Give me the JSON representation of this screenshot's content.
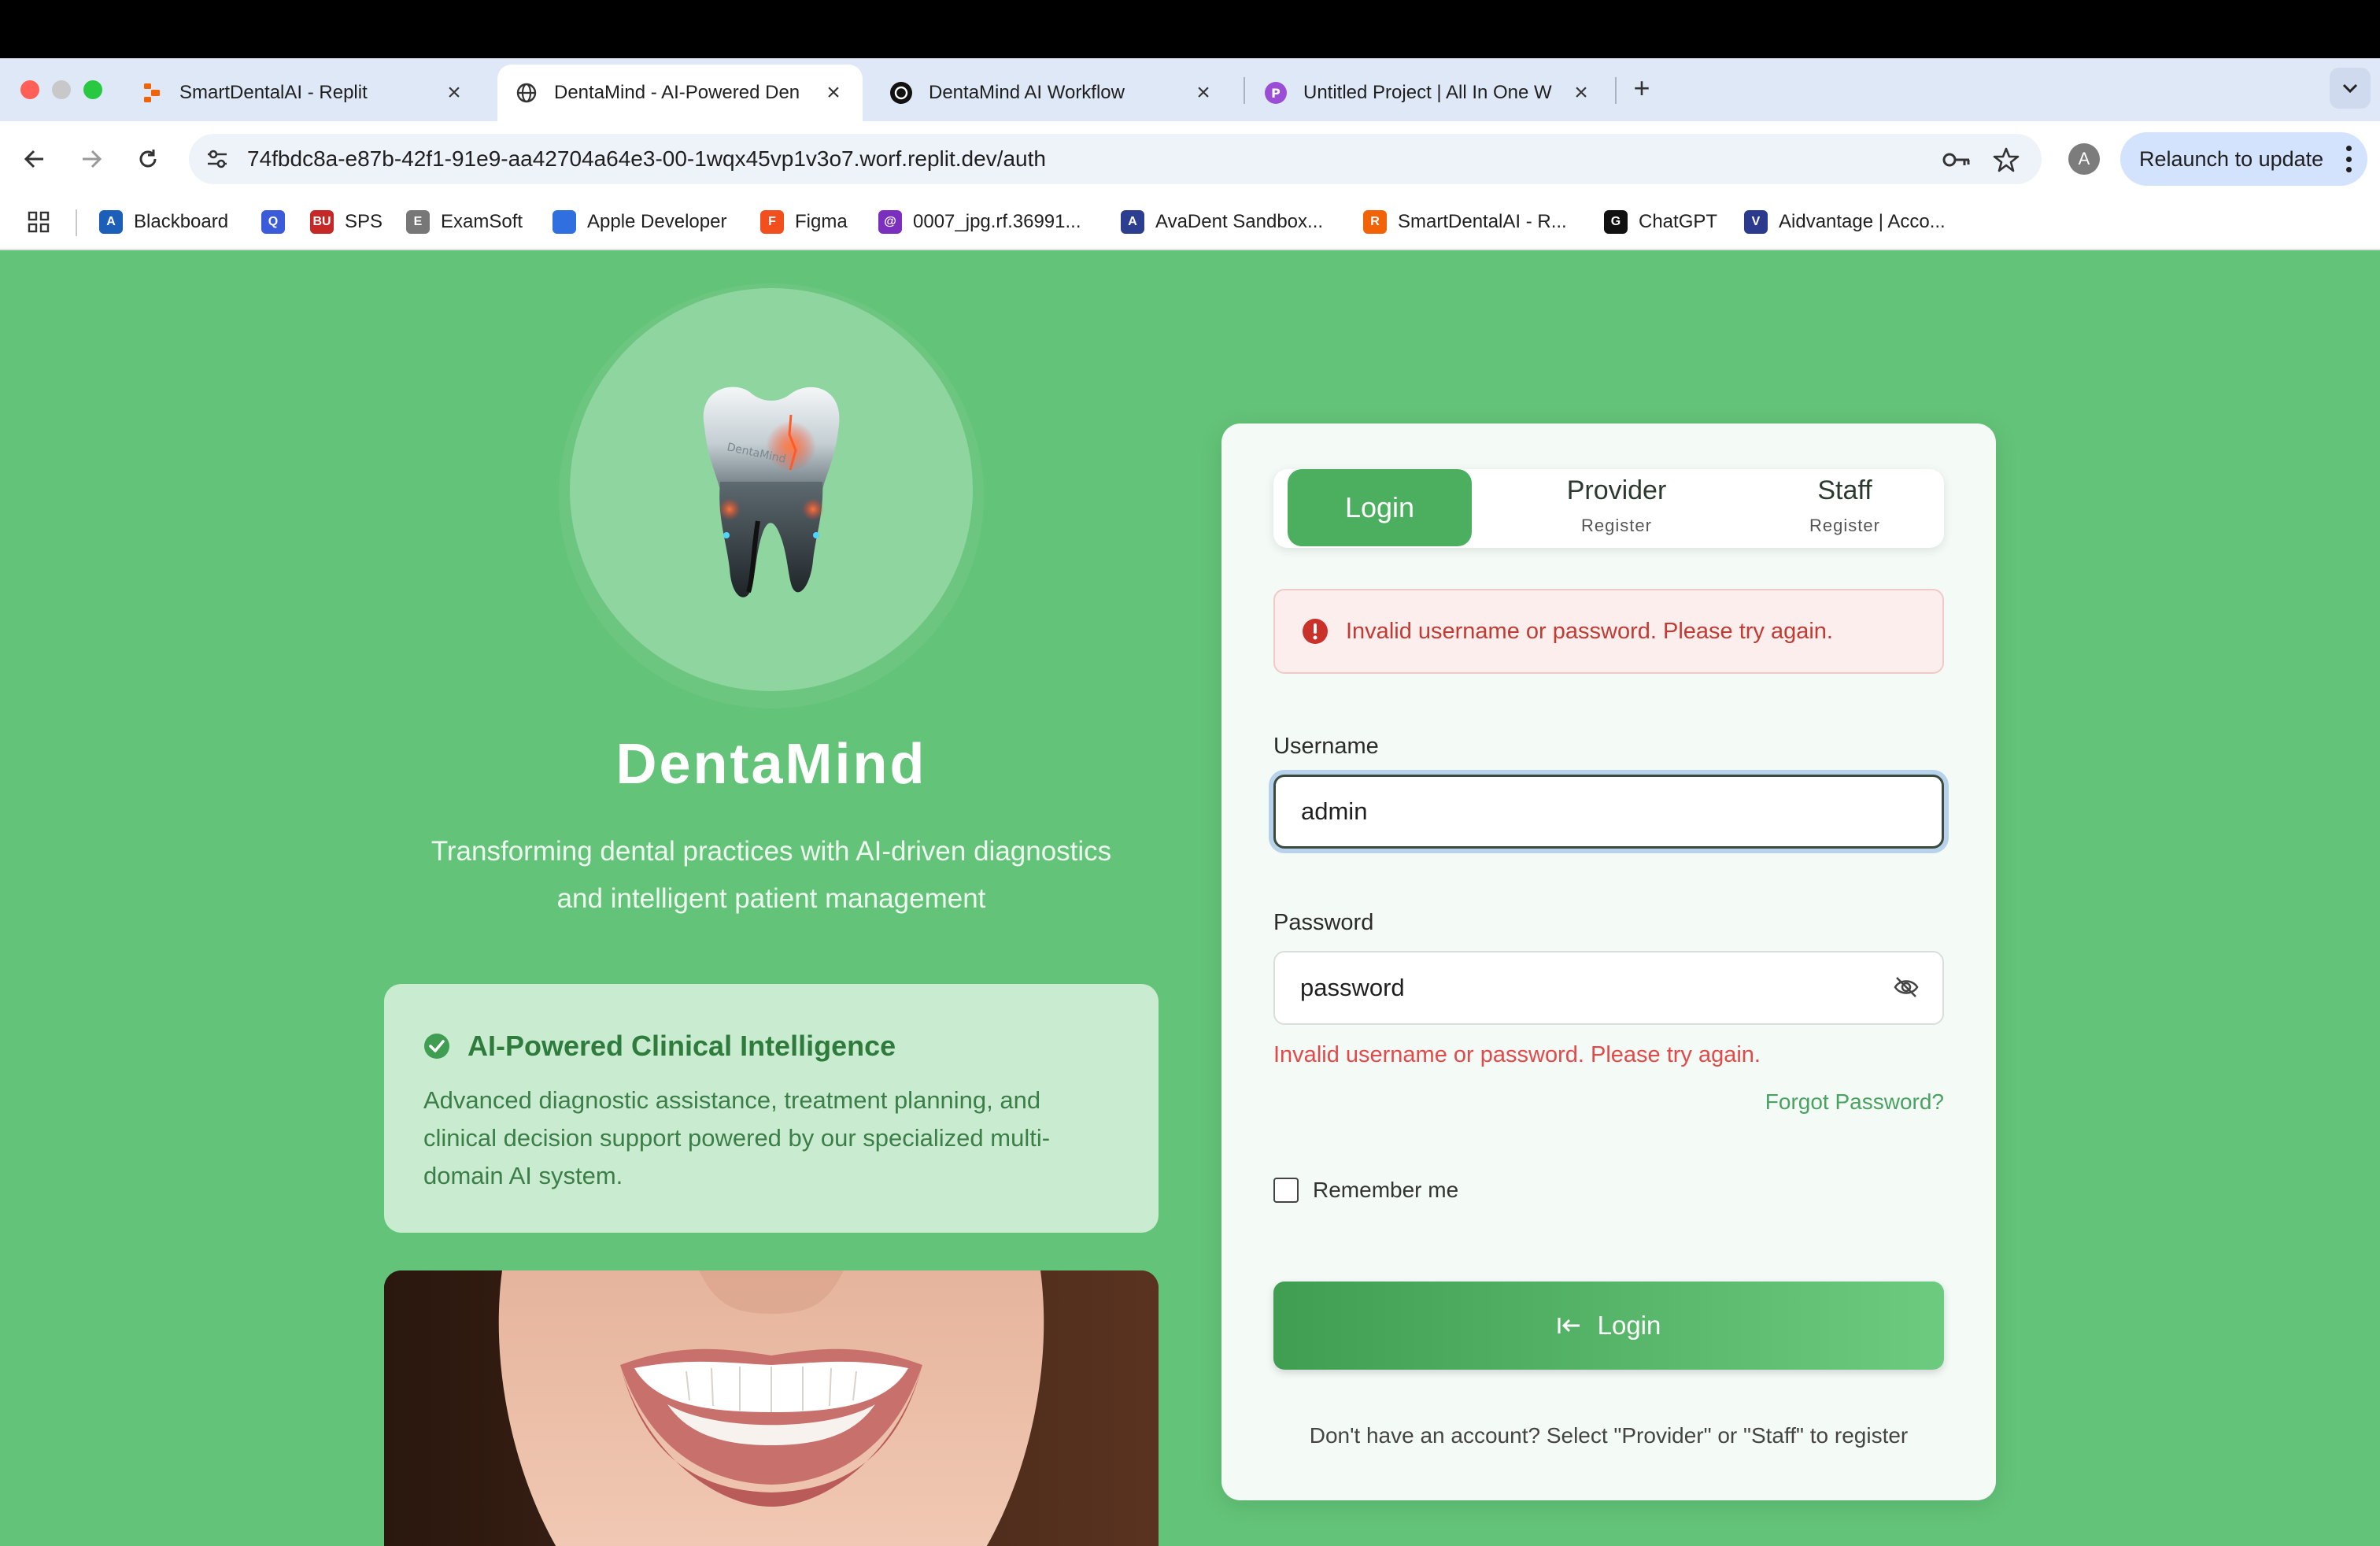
{
  "browser": {
    "tabs": [
      {
        "title": "SmartDentalAI - Replit",
        "icon": "replit-icon"
      },
      {
        "title": "DentaMind - AI-Powered Den",
        "icon": "globe-icon",
        "active": true
      },
      {
        "title": "DentaMind AI Workflow",
        "icon": "openai-icon"
      },
      {
        "title": "Untitled Project | All In One W",
        "icon": "project-icon"
      }
    ],
    "url": "74fbdc8a-e87b-42f1-91e9-aa42704a64e3-00-1wqx45vp1v3o7.worf.replit.dev/auth",
    "profile_initial": "A",
    "relaunch_label": "Relaunch to update",
    "bookmarks": [
      {
        "label": "Blackboard",
        "color": "#1b5fb8",
        "glyph": "A"
      },
      {
        "label": "",
        "color": "#3b5bdb",
        "glyph": "Q"
      },
      {
        "label": "SPS",
        "color": "#c62828",
        "glyph": "BU"
      },
      {
        "label": "ExamSoft",
        "color": "#777777",
        "glyph": "E"
      },
      {
        "label": "Apple Developer",
        "color": "#2f6fe0",
        "glyph": ""
      },
      {
        "label": "Figma",
        "color": "#f24e1e",
        "glyph": "F"
      },
      {
        "label": "0007_jpg.rf.36991...",
        "color": "#7b2fbf",
        "glyph": "@"
      },
      {
        "label": "AvaDent Sandbox...",
        "color": "#2c3e8f",
        "glyph": "A"
      },
      {
        "label": "SmartDentalAI - R...",
        "color": "#f26207",
        "glyph": "R"
      },
      {
        "label": "ChatGPT",
        "color": "#111111",
        "glyph": "G"
      },
      {
        "label": "Aidvantage | Acco...",
        "color": "#2b3a8c",
        "glyph": "V"
      }
    ]
  },
  "hero": {
    "brand": "DentaMind",
    "tagline": "Transforming dental practices with AI-driven diagnostics and intelligent patient management",
    "feature_title": "AI-Powered Clinical Intelligence",
    "feature_desc": "Advanced diagnostic assistance, treatment planning, and clinical decision support powered by our specialized multi-domain AI system.",
    "tooth_label": "DentaMind"
  },
  "auth": {
    "tabs": {
      "login": "Login",
      "provider": "Provider",
      "provider_sub": "Register",
      "staff": "Staff",
      "staff_sub": "Register"
    },
    "alert": "Invalid username or password. Please try again.",
    "username_label": "Username",
    "username_value": "admin",
    "password_label": "Password",
    "password_value": "password",
    "field_error": "Invalid username or password. Please try again.",
    "forgot": "Forgot Password?",
    "remember": "Remember me",
    "submit": "Login",
    "footnote": "Don't have an account? Select \"Provider\" or \"Staff\" to register"
  },
  "colors": {
    "page_bg": "#63c378",
    "primary": "#4caf5f",
    "error": "#c23b33"
  }
}
